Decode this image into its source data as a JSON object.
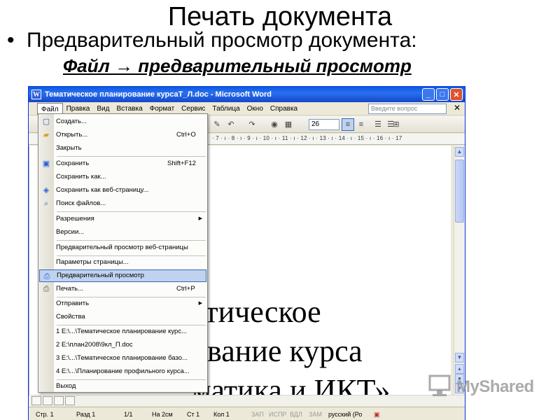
{
  "slide": {
    "title": "Печать документа",
    "bullet": "Предварительный просмотр документа:",
    "path": "Файл → предварительный просмотр"
  },
  "window": {
    "title": "Тематическое планирование курсаТ_Л.doc - Microsoft Word",
    "icon_letter": "W",
    "buttons": {
      "minimize": "_",
      "maximize": "□",
      "close": "✕"
    }
  },
  "menubar": {
    "items": [
      "Файл",
      "Правка",
      "Вид",
      "Вставка",
      "Формат",
      "Сервис",
      "Таблица",
      "Окно",
      "Справка"
    ],
    "ask_placeholder": "Введите вопрос",
    "close": "✕"
  },
  "toolbar": {
    "font_size": "26"
  },
  "ruler": {
    "text": "· 7 · ı · 8 · ı · 9 · ı · 10 · ı · 11 · ı · 12 · ı · 13 · ı · 14 · ı · 15 · ı · 16 · ı · 17"
  },
  "document": {
    "lines": [
      "атическое",
      "ование курса",
      "матика и ИКТ»"
    ]
  },
  "file_menu": {
    "items": [
      {
        "label": "Создать...",
        "shortcut": ""
      },
      {
        "label": "Открыть...",
        "shortcut": "Ctrl+O"
      },
      {
        "label": "Закрыть",
        "shortcut": ""
      },
      {
        "label": "Сохранить",
        "shortcut": "Shift+F12"
      },
      {
        "label": "Сохранить как...",
        "shortcut": ""
      },
      {
        "label": "Сохранить как веб-страницу...",
        "shortcut": ""
      },
      {
        "label": "Поиск файлов...",
        "shortcut": ""
      },
      {
        "label": "Разрешения",
        "shortcut": ""
      },
      {
        "label": "Версии...",
        "shortcut": ""
      },
      {
        "label": "Предварительный просмотр веб-страницы",
        "shortcut": ""
      },
      {
        "label": "Параметры страницы...",
        "shortcut": ""
      },
      {
        "label": "Предварительный просмотр",
        "shortcut": ""
      },
      {
        "label": "Печать...",
        "shortcut": "Ctrl+P"
      },
      {
        "label": "Отправить",
        "shortcut": ""
      },
      {
        "label": "Свойства",
        "shortcut": ""
      },
      {
        "label": "1 E:\\...\\Тематическое планирование курс...",
        "shortcut": ""
      },
      {
        "label": "2 E:\\план2008\\9кл_П.doc",
        "shortcut": ""
      },
      {
        "label": "3 E:\\...\\Тематическое планирование базо...",
        "shortcut": ""
      },
      {
        "label": "4 E:\\...\\Планирование профильного курса...",
        "shortcut": ""
      },
      {
        "label": "Выход",
        "shortcut": ""
      }
    ],
    "highlighted": "Предварительный просмотр"
  },
  "statusbar": {
    "page": "Стр. 1",
    "section": "Разд 1",
    "pages": "1/1",
    "at": "На 2см",
    "line": "Ст 1",
    "col": "Кол 1",
    "rec": "ЗАП",
    "trk": "ИСПР",
    "ext": "ВДЛ",
    "ovr": "ЗАМ",
    "lang": "русский (Ро"
  },
  "watermark": {
    "text": "MyShared"
  },
  "icons": {
    "new": "new-document-icon",
    "open": "open-folder-icon",
    "save": "save-icon",
    "web": "web-page-icon",
    "search": "search-files-icon",
    "preview": "print-preview-icon",
    "print": "printer-icon"
  }
}
